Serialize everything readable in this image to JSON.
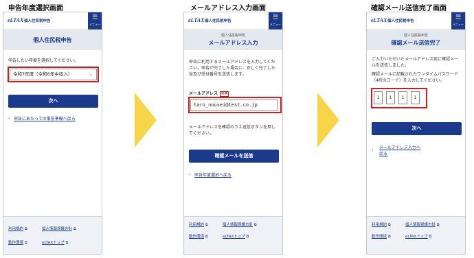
{
  "screens": [
    {
      "caption": "申告年度選択画面",
      "header": {
        "logo": "eLTAX",
        "logo_sub": "個人住民税申告",
        "menu_label": "メニュー"
      },
      "title_only": "個人住民税申告",
      "instruction": "申告したい年度を選択してください。",
      "select_value": "令和7年度（令和6年中収入）",
      "primary_button": "次へ",
      "back_link": "申告にあたっての事前準備へ戻る"
    },
    {
      "caption": "メールアドレス入力画面",
      "header": {
        "logo": "eLTAX",
        "logo_sub": "個人住民税申告",
        "menu_label": "メニュー"
      },
      "title_small": "個人住民税申告",
      "title_large": "メールアドレス入力",
      "description": "申告に利用するメールアドレスを入力してください。申告が完了した場合に、正しく完了した旨及び受付番号を送信します。",
      "email_label": "メールアドレス",
      "required_badge": "必須",
      "email_value": "taro_nousei@test.co.jp",
      "note": "メールアドレスを確認のうえ送信ボタンを押してください。",
      "primary_button": "確認メールを送信",
      "back_link": "申告年度選択へ戻る"
    },
    {
      "caption": "確認メール送信完了画面",
      "header": {
        "logo": "eLTAX",
        "logo_sub": "個人住民税申告",
        "menu_label": "メニュー"
      },
      "title_small": "個人住民税申告",
      "title_large": "確認メール送信完了",
      "description": "ご入力いただいたメールアドレス宛に確認メールを送信しました。",
      "otp_instruction": "確認メールに記載されたワンタイムパスワード（4桁のコード）を入力してください。",
      "otp_digits": [
        "1",
        "1",
        "1",
        "1"
      ],
      "primary_button": "次へ",
      "back_link": "メールアドレス入力へ戻る"
    }
  ],
  "footer": {
    "terms": "利用規約",
    "privacy": "個人情報保護方針",
    "env": "動作環境",
    "top": "eLTAXトップ"
  },
  "colors": {
    "brand": "#1b3a8c",
    "highlight": "#d51a1a",
    "arrow": "#f7d548",
    "band": "#e4e9ef"
  }
}
